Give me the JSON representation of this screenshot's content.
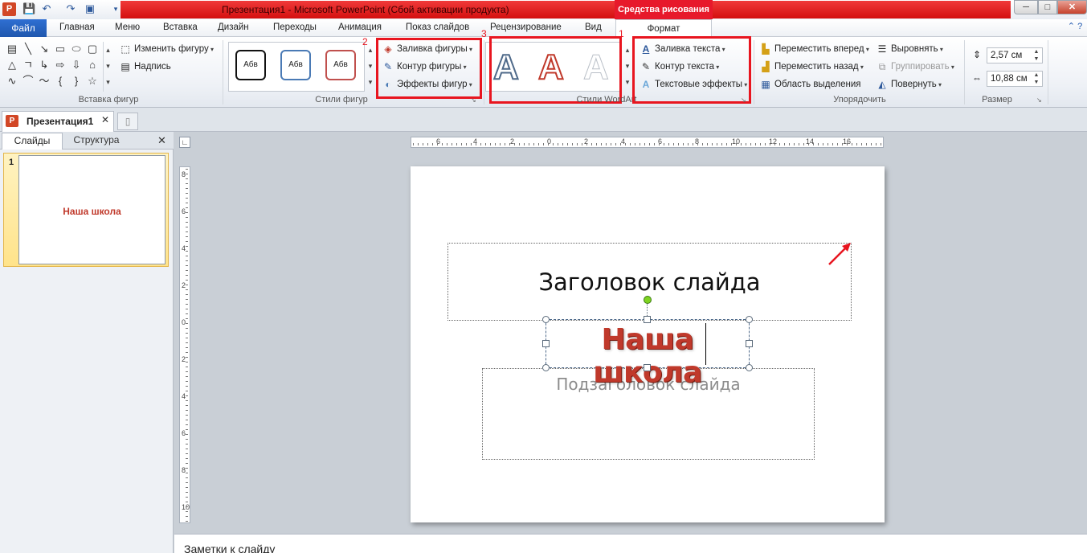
{
  "titlebar": {
    "title": "Презентация1 - Microsoft PowerPoint (Сбой активации продукта)",
    "contextual_tab_group": "Средства рисования",
    "app_icon_letter": "P",
    "minimize": "─",
    "maximize": "□",
    "close": "✕",
    "qat": [
      "save-icon",
      "undo-icon",
      "redo-icon",
      "slide-show-icon",
      "customize-icon"
    ]
  },
  "tabs": {
    "file": "Файл",
    "items": [
      "Главная",
      "Меню",
      "Вставка",
      "Дизайн",
      "Переходы",
      "Анимация",
      "Показ слайдов",
      "Рецензирование",
      "Вид"
    ],
    "active": "Формат"
  },
  "ribbon": {
    "insert_shapes": {
      "label": "Вставка фигур",
      "edit_shape": "Изменить фигуру",
      "textbox": "Надпись"
    },
    "shape_styles": {
      "label": "Стили фигур",
      "samples": [
        "Абв",
        "Абв",
        "Абв"
      ],
      "fill": "Заливка фигуры",
      "outline": "Контур фигуры",
      "effects": "Эффекты фигур"
    },
    "wordart": {
      "label": "Стили WordArt",
      "glyph": "A",
      "text_fill": "Заливка текста",
      "text_outline": "Контур текста",
      "text_effects": "Текстовые эффекты"
    },
    "arrange": {
      "label": "Упорядочить",
      "bring_forward": "Переместить вперед",
      "send_backward": "Переместить назад",
      "selection_pane": "Область выделения",
      "align": "Выровнять",
      "group": "Группировать",
      "rotate": "Повернуть"
    },
    "size": {
      "label": "Размер",
      "height": "2,57 см",
      "width": "10,88 см"
    }
  },
  "annotations": {
    "num_1": "1",
    "num_2": "2",
    "num_3": "3"
  },
  "document": {
    "tab_name": "Презентация1",
    "tab_close": "✕"
  },
  "left_panel": {
    "tab_slides": "Слайды",
    "tab_outline": "Структура",
    "close": "✕",
    "slide_number": "1",
    "thumb_text": "Наша школа"
  },
  "rulers": {
    "horizontal": [
      "6",
      "4",
      "2",
      "0",
      "2",
      "4",
      "6",
      "8",
      "10",
      "12",
      "14",
      "16"
    ],
    "vertical": [
      "8",
      "6",
      "4",
      "2",
      "0",
      "2",
      "4",
      "6",
      "8",
      "10"
    ]
  },
  "slide": {
    "title_placeholder": "Заголовок слайда",
    "subtitle_placeholder": "Подзаголовок слайда",
    "wordart_text": "Наша школа"
  },
  "notes": {
    "placeholder": "Заметки к слайду"
  },
  "colors": {
    "accent_red": "#e8151f",
    "file_tab": "#2f6fd2",
    "wordart_red": "#c0392b"
  }
}
